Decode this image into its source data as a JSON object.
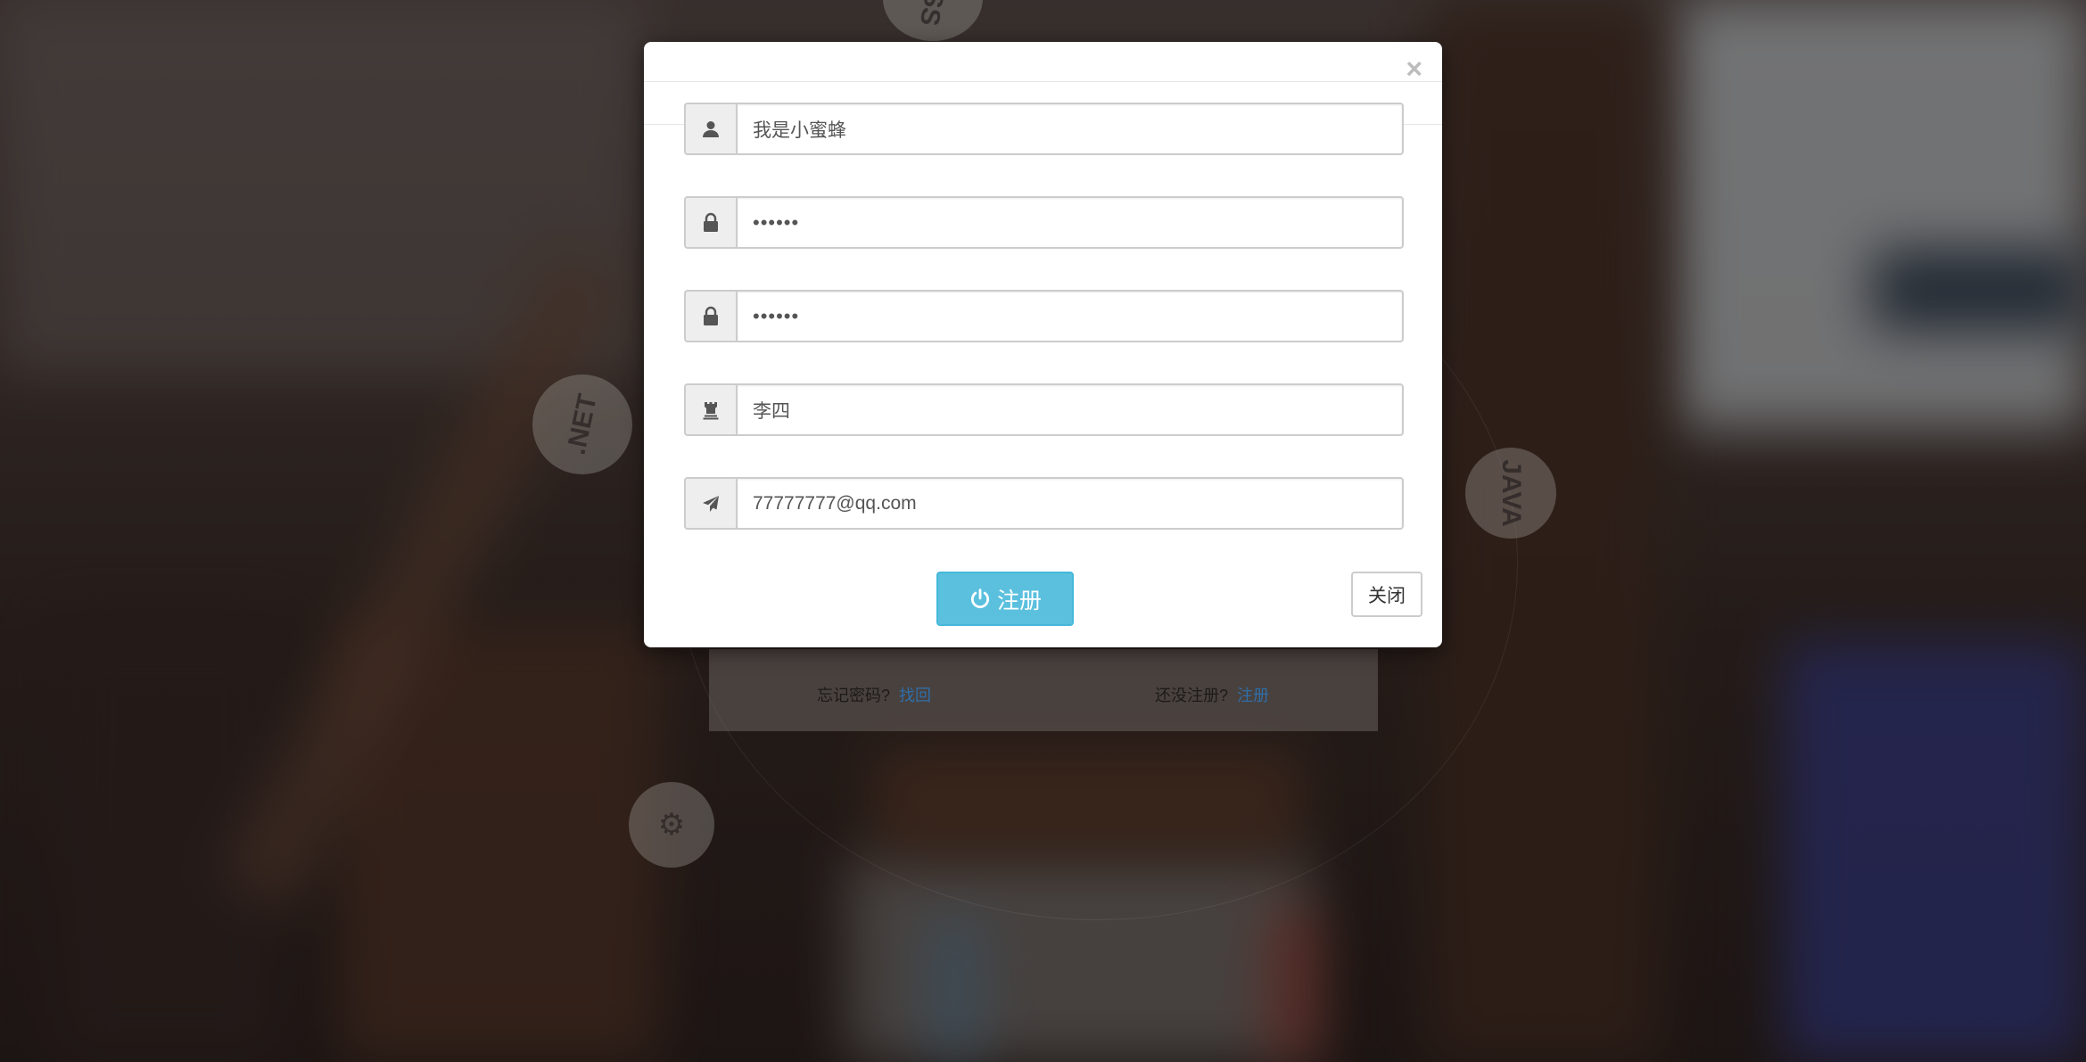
{
  "background": {
    "badges": [
      {
        "label": ".NET"
      },
      {
        "label": "JAVA"
      },
      {
        "label": "CSS"
      },
      {
        "label": "⚙"
      }
    ],
    "login_panel": {
      "forgot_text": "忘记密码?",
      "forgot_link": "找回",
      "signup_text": "还没注册?",
      "signup_link": "注册"
    }
  },
  "modal": {
    "close_glyph": "×",
    "fields": [
      {
        "icon": "user-icon",
        "value": "我是小蜜蜂",
        "type": "text"
      },
      {
        "icon": "lock-icon",
        "value": "••••••",
        "type": "password"
      },
      {
        "icon": "lock-icon",
        "value": "••••••",
        "type": "password"
      },
      {
        "icon": "tower-icon",
        "value": "李四",
        "type": "text"
      },
      {
        "icon": "send-icon",
        "value": "77777777@qq.com",
        "type": "text"
      }
    ],
    "register_button": {
      "label": "注册",
      "icon": "power-icon"
    },
    "close_button": {
      "label": "关闭"
    }
  },
  "colors": {
    "primary_button": "#5bc0de",
    "link": "#2f6ea8"
  }
}
